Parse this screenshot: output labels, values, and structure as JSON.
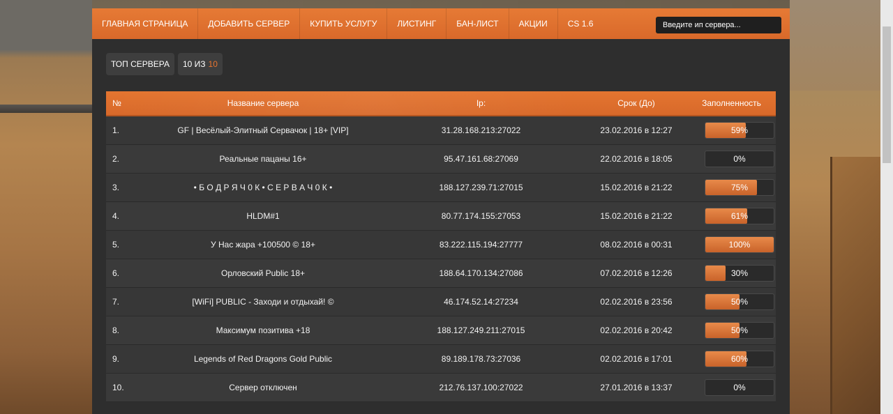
{
  "nav": {
    "items": [
      "ГЛАВНАЯ СТРАНИЦА",
      "ДОБАВИТЬ СЕРВЕР",
      "КУПИТЬ УСЛУГУ",
      "ЛИСТИНГ",
      "БАН-ЛИСТ",
      "АКЦИИ",
      "CS 1.6"
    ],
    "search_placeholder": "Введите ип сервера..."
  },
  "toolbar": {
    "top_label": "ТОП СЕРВЕРА",
    "count_prefix": "10 ИЗ",
    "count_total": "10"
  },
  "table": {
    "headers": {
      "num": "№",
      "name": "Название сервера",
      "ip": "Ip:",
      "date": "Срок (До)",
      "fill": "Заполненность"
    },
    "rows": [
      {
        "num": "1.",
        "name": "GF | Весёлый-Элитный Сервачок | 18+ [VIP]",
        "ip": "31.28.168.213:27022",
        "date": "23.02.2016 в 12:27",
        "fill": 59,
        "fill_label": "59%"
      },
      {
        "num": "2.",
        "name": "Реальные пацаны 16+",
        "ip": "95.47.161.68:27069",
        "date": "22.02.2016 в 18:05",
        "fill": 0,
        "fill_label": "0%"
      },
      {
        "num": "3.",
        "name": "• Б О Д Р Я Ч 0 К • С Е Р В А Ч 0 К •",
        "ip": "188.127.239.71:27015",
        "date": "15.02.2016 в 21:22",
        "fill": 75,
        "fill_label": "75%"
      },
      {
        "num": "4.",
        "name": "HLDM#1",
        "ip": "80.77.174.155:27053",
        "date": "15.02.2016 в 21:22",
        "fill": 61,
        "fill_label": "61%"
      },
      {
        "num": "5.",
        "name": "У Нас жара +100500 © 18+",
        "ip": "83.222.115.194:27777",
        "date": "08.02.2016 в 00:31",
        "fill": 100,
        "fill_label": "100%"
      },
      {
        "num": "6.",
        "name": "Орловский Public 18+",
        "ip": "188.64.170.134:27086",
        "date": "07.02.2016 в 12:26",
        "fill": 30,
        "fill_label": "30%"
      },
      {
        "num": "7.",
        "name": "[WiFi] PUBLIC - Заходи и отдыхай! ©",
        "ip": "46.174.52.14:27234",
        "date": "02.02.2016 в 23:56",
        "fill": 50,
        "fill_label": "50%"
      },
      {
        "num": "8.",
        "name": "Максимум позитива +18",
        "ip": "188.127.249.211:27015",
        "date": "02.02.2016 в 20:42",
        "fill": 50,
        "fill_label": "50%"
      },
      {
        "num": "9.",
        "name": "Legends of Red Dragons Gold Public",
        "ip": "89.189.178.73:27036",
        "date": "02.02.2016 в 17:01",
        "fill": 60,
        "fill_label": "60%"
      },
      {
        "num": "10.",
        "name": "Сервер отключен",
        "ip": "212.76.137.100:27022",
        "date": "27.01.2016 в 13:37",
        "fill": 0,
        "fill_label": "0%"
      }
    ]
  },
  "colors": {
    "accent": "#e2702e",
    "panel": "#2e2e2e",
    "row": "#3a3a3a"
  }
}
